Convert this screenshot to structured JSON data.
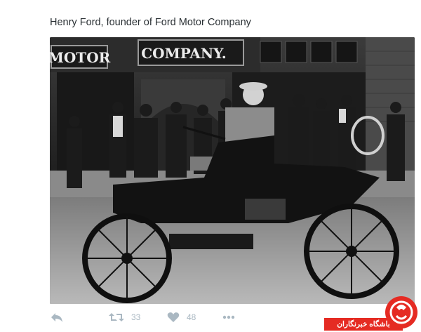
{
  "tweet": {
    "text": "Henry Ford, founder of Ford Motor Company"
  },
  "photo": {
    "sign_left": "MOTOR",
    "sign_right": "COMPANY."
  },
  "actions": {
    "reply_icon": "reply-icon",
    "retweet_icon": "retweet-icon",
    "retweet_count": "33",
    "like_icon": "heart-icon",
    "like_count": "48",
    "more_icon": "more-icon"
  },
  "watermark": {
    "label": "باشگاه خبرنگاران",
    "brand_color": "#e52b23"
  }
}
